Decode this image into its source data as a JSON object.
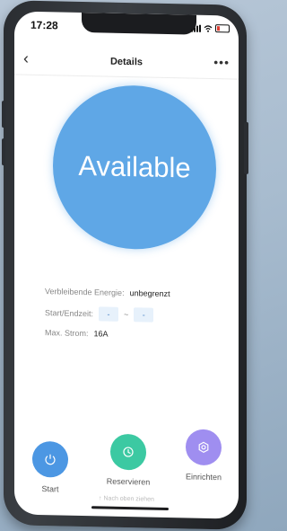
{
  "status_bar": {
    "time": "17:28"
  },
  "nav": {
    "back_symbol": "‹",
    "title": "Details",
    "more_symbol": "•••"
  },
  "status": {
    "label": "Available",
    "color": "#5fa7e6"
  },
  "info": {
    "energy_label": "Verbleibende Energie:",
    "energy_value": "unbegrenzt",
    "time_label": "Start/Endzeit:",
    "start_value": "-",
    "separator": "~",
    "end_value": "-",
    "current_label": "Max. Strom:",
    "current_value": "16A"
  },
  "actions": [
    {
      "label": "Start",
      "icon": "power-icon",
      "color": "#4c97e3"
    },
    {
      "label": "Reservieren",
      "icon": "clock-icon",
      "color": "#3cc9a2"
    },
    {
      "label": "Einrichten",
      "icon": "settings-icon",
      "color": "#9f8ef0"
    }
  ],
  "home_hint": "↑ Nach oben ziehen"
}
